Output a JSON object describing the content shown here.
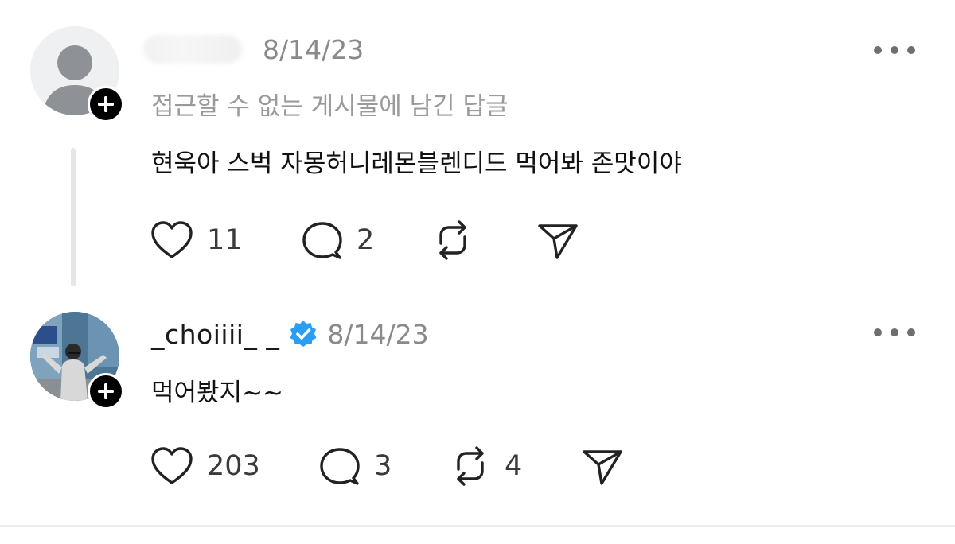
{
  "posts": [
    {
      "username": "",
      "username_blurred": true,
      "verified": false,
      "timestamp": "8/14/23",
      "subnote": "접근할 수 없는 게시물에 남긴 답글",
      "text": "현욱아 스벅 자몽허니레몬블렌디드 먹어봐 존맛이야",
      "likes": "11",
      "replies": "2",
      "reposts": "",
      "has_thread_line": true
    },
    {
      "username": "_choiiii_ _",
      "verified": true,
      "timestamp": "8/14/23",
      "text": "먹어봤지~~",
      "likes": "203",
      "replies": "3",
      "reposts": "4",
      "has_thread_line": false
    }
  ],
  "icons": {
    "like": "heart-icon",
    "reply": "comment-bubble-icon",
    "repost": "repost-arrows-icon",
    "share": "send-paper-plane-icon",
    "more": "more-dots-icon",
    "follow": "plus-icon",
    "verified": "verified-badge-icon"
  },
  "colors": {
    "verified_blue": "#2a9df4",
    "timestamp_gray": "#8a8a8a",
    "icon_dark": "#222222"
  }
}
